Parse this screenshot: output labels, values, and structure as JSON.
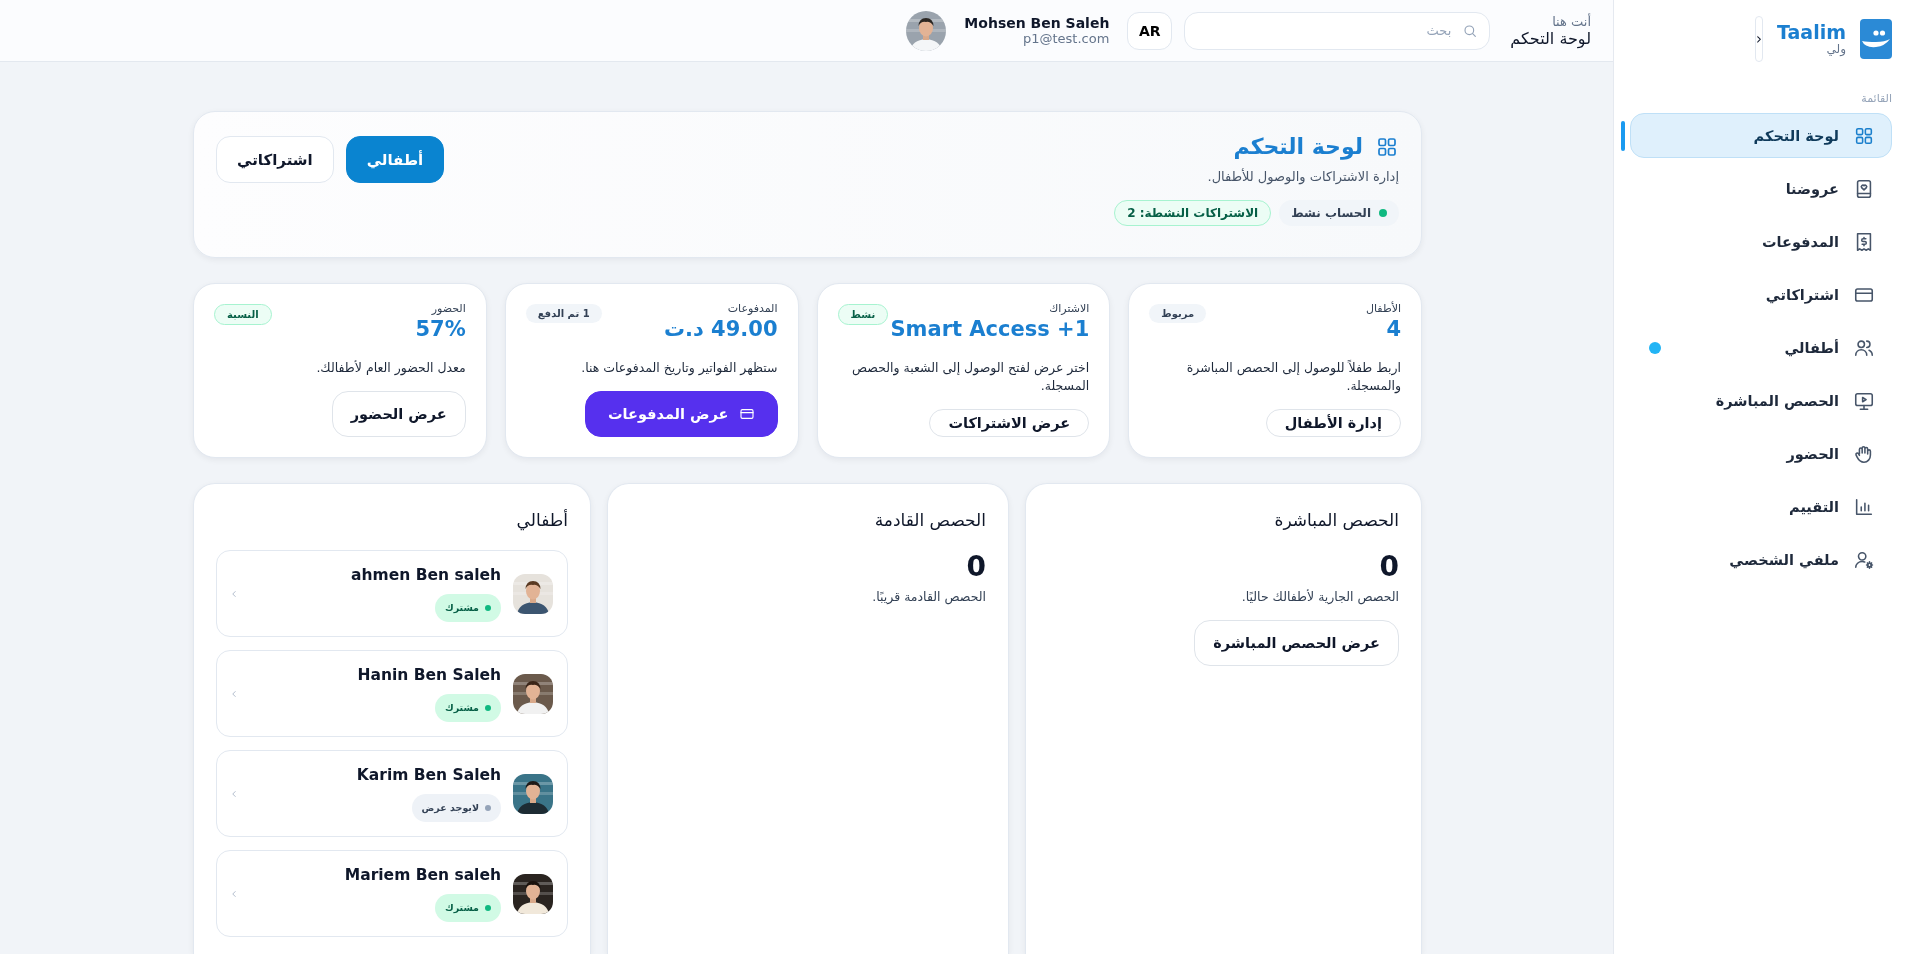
{
  "sidebar": {
    "brand": "Taalim",
    "role": "ولي",
    "collapse_button": "‹",
    "section_label": "القائمة",
    "items": [
      {
        "label": "لوحة التحكم",
        "selected": true,
        "dot": false
      },
      {
        "label": "عروضنا",
        "selected": false,
        "dot": false
      },
      {
        "label": "المدفوعات",
        "selected": false,
        "dot": false
      },
      {
        "label": "اشتراكاتي",
        "selected": false,
        "dot": false
      },
      {
        "label": "أطفالي",
        "selected": false,
        "dot": true
      },
      {
        "label": "الحصص المباشرة",
        "selected": false,
        "dot": false
      },
      {
        "label": "الحضور",
        "selected": false,
        "dot": false
      },
      {
        "label": "التقييم",
        "selected": false,
        "dot": false
      },
      {
        "label": "ملفي الشخصي",
        "selected": false,
        "dot": false
      }
    ]
  },
  "topbar": {
    "breadcrumb_label": "أنت هنا",
    "breadcrumb_current": "لوحة التحكم",
    "search": {
      "placeholder": "بحث"
    },
    "language_button": "AR",
    "user": {
      "name": "Mohsen Ben Saleh",
      "email": "p1@test.com"
    }
  },
  "header": {
    "title": "لوحة التحكم",
    "subtitle": "إدارة الاشتراكات والوصول للأطفال.",
    "chips": [
      {
        "label": "الحساب نشط",
        "kind": "status"
      },
      {
        "label": "الاشتراكات النشطة: 2",
        "kind": "count"
      }
    ],
    "tabs": [
      {
        "label": "أطفالي",
        "selected": true
      },
      {
        "label": "اشتراكاتي",
        "selected": false
      }
    ]
  },
  "stat_cards": [
    {
      "label": "الأطفال",
      "value": "4",
      "badge": {
        "label": "مربوط",
        "kind": "neutral"
      },
      "description": "اربط طفلاً للوصول إلى الحصص المباشرة والمسجلة.",
      "button": {
        "label": "إدارة الأطفال",
        "kind": "outline"
      }
    },
    {
      "label": "الاشتراك",
      "value": "Smart Access +1",
      "badge": {
        "label": "نشط",
        "kind": "success"
      },
      "description": "اختر عرض لفتح الوصول إلى الشعبة والحصص المسجلة.",
      "button": {
        "label": "عرض الاشتراكات",
        "kind": "outline"
      }
    },
    {
      "label": "المدفوعات",
      "value": "49.00 د.ت",
      "badge": {
        "label": "1 تم الدفع",
        "kind": "neutral"
      },
      "description": "ستظهر الفواتير وتاريخ المدفوعات هنا.",
      "button": {
        "label": "عرض المدفوعات",
        "kind": "primary"
      }
    },
    {
      "label": "الحضور",
      "value": "57%",
      "badge": {
        "label": "النسبة",
        "kind": "success"
      },
      "description": "معدل الحضور العام لأطفالك.",
      "button": {
        "label": "عرض الحضور",
        "kind": "outline"
      }
    }
  ],
  "live_sessions": {
    "title": "الحصص المباشرة",
    "count": "0",
    "description": "الحصص الجارية لأطفالك حاليًا.",
    "button": "عرض الحصص المباشرة"
  },
  "upcoming_sessions": {
    "title": "الحصص القادمة",
    "count": "0",
    "description": "الحصص القادمة قريبًا."
  },
  "kids": {
    "title": "أطفالي",
    "items": [
      {
        "name": "ahmen Ben saleh",
        "status": "مشترك",
        "subscribed": true
      },
      {
        "name": "Hanin Ben Saleh",
        "status": "مشترك",
        "subscribed": true
      },
      {
        "name": "Karim Ben Saleh",
        "status": "لايوجد عرض",
        "subscribed": false
      },
      {
        "name": "Mariem Ben saleh",
        "status": "مشترك",
        "subscribed": true
      }
    ]
  }
}
